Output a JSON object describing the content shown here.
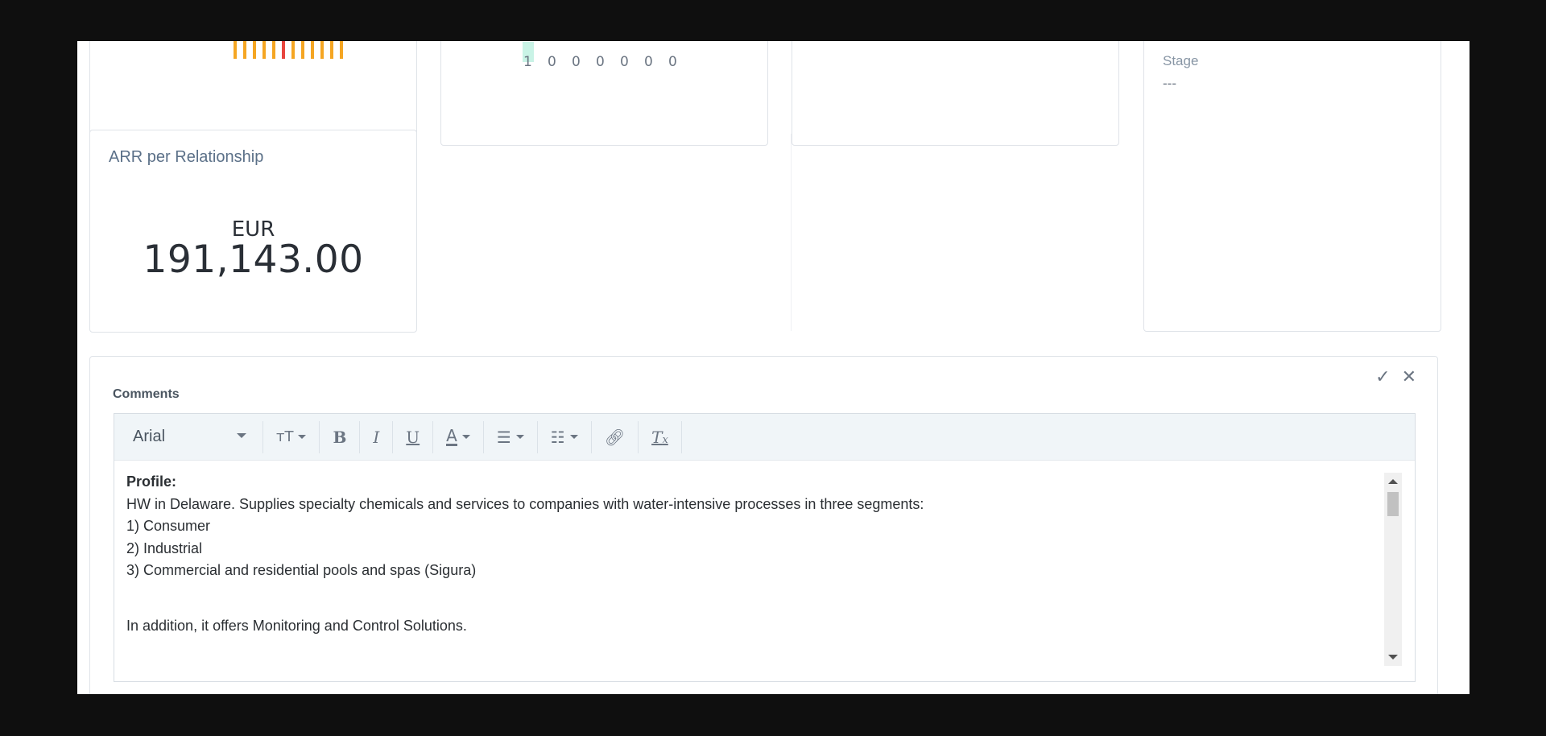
{
  "kpi": {
    "title": "ARR per Relationship",
    "currency": "EUR",
    "value": "191,143.00"
  },
  "chart_data": {
    "type": "bar",
    "categories": [
      "",
      "",
      "",
      "",
      "",
      "",
      ""
    ],
    "tick_labels": [
      "1",
      "0",
      "0",
      "0",
      "0",
      "0",
      "0"
    ],
    "values": [
      1,
      0,
      0,
      0,
      0,
      0,
      0
    ]
  },
  "stage": {
    "label": "Stage",
    "value": "---"
  },
  "comments": {
    "label": "Comments",
    "confirm_icon": "check-icon",
    "close_icon": "close-icon",
    "toolbar": {
      "font": "Arial"
    },
    "lines": [
      "HW in Delaware. Supplies specialty chemicals and services to companies with water-intensive processes in three segments:",
      "1) Consumer",
      "2) Industrial",
      "3) Commercial and residential pools and spas (Sigura)",
      "",
      "In addition, it offers Monitoring and Control Solutions."
    ],
    "heading": "Profile:"
  },
  "colors": {
    "bar_orange": "#f5a623",
    "bar_red": "#e8463e"
  }
}
